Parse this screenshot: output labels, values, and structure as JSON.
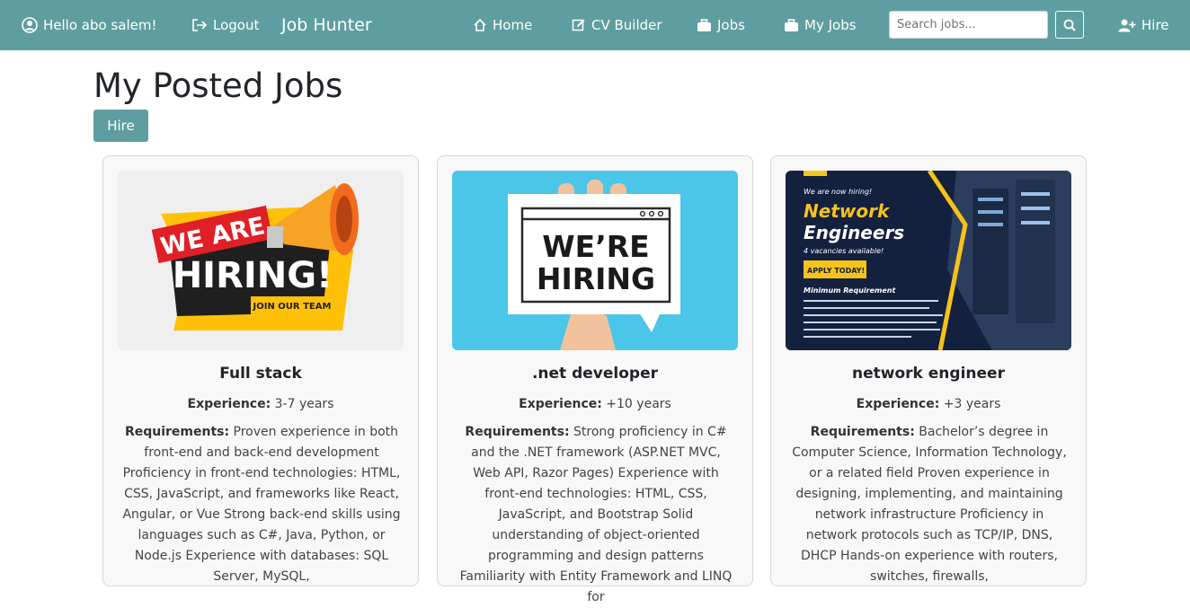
{
  "navbar": {
    "greeting": "Hello abo salem!",
    "logout": "Logout",
    "brand": "Job Hunter",
    "home": "Home",
    "cv_builder": "CV Builder",
    "jobs": "Jobs",
    "my_jobs": "My Jobs",
    "search_placeholder": "Search jobs...",
    "hire": "Hire"
  },
  "page": {
    "title": "My Posted Jobs",
    "hire_button": "Hire"
  },
  "labels": {
    "experience": "Experience:",
    "requirements": "Requirements:"
  },
  "jobs": [
    {
      "title": "Full stack",
      "experience": "3-7 years",
      "requirements": "Proven experience in both front-end and back-end development Proficiency in front-end technologies: HTML, CSS, JavaScript, and frameworks like React, Angular, or Vue Strong back-end skills using languages such as C#, Java, Python, or Node.js Experience with databases: SQL Server, MySQL,",
      "image": {
        "line1": "WE ARE",
        "line2": "HIRING!",
        "tag": "JOIN OUR TEAM"
      }
    },
    {
      "title": ".net developer",
      "experience": "+10 years",
      "requirements": "Strong proficiency in C# and the .NET framework (ASP.NET MVC, Web API, Razor Pages) Experience with front-end technologies: HTML, CSS, JavaScript, and Bootstrap Solid understanding of object-oriented programming and design patterns Familiarity with Entity Framework and LINQ for",
      "image": {
        "line1": "WE’RE",
        "line2": "HIRING"
      }
    },
    {
      "title": "network engineer",
      "experience": "+3 years",
      "requirements": "Bachelor’s degree in Computer Science, Information Technology, or a related field Proven experience in designing, implementing, and maintaining network infrastructure Proficiency in network protocols such as TCP/IP, DNS, DHCP Hands-on experience with routers, switches, firewalls,",
      "image": {
        "kicker": "We are now hiring!",
        "line1": "Network",
        "line2": "Engineers",
        "vacancies": "4 vacancies available!",
        "apply": "APPLY TODAY!",
        "min_req": "Minimum Requirement"
      }
    }
  ],
  "colors": {
    "navbar": "#5f9ea0",
    "button": "#5f9ea0",
    "card_bg": "#f8f8f9"
  }
}
